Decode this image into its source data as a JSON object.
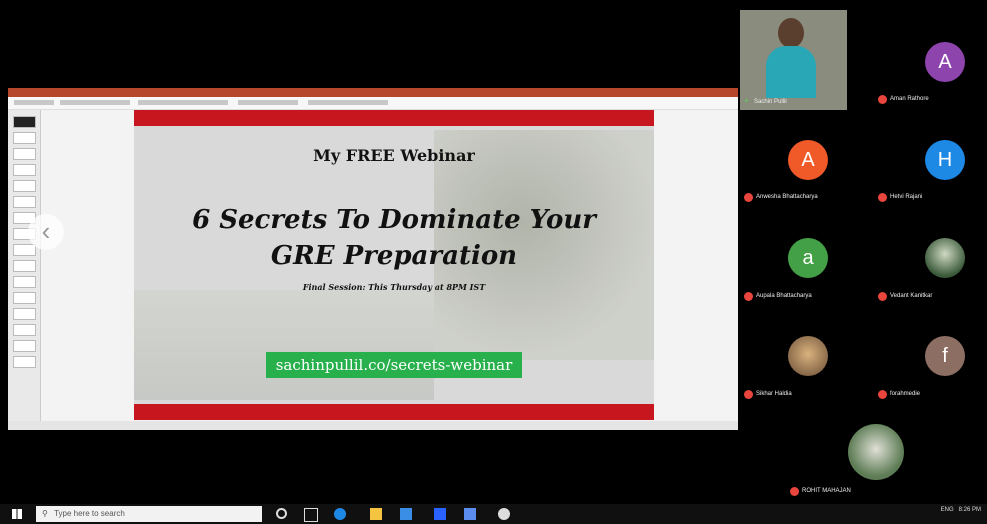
{
  "slide": {
    "heading": "My FREE Webinar",
    "title": "6 Secrets To Dominate Your GRE Preparation",
    "subtitle": "Final Session: This Thursday at 8PM IST",
    "link_text": "sachinpullil.co/secrets-webinar"
  },
  "participants": [
    {
      "initial": "",
      "name": "Sachin Pullil",
      "color": "#4a4a4a"
    },
    {
      "initial": "A",
      "name": "Aman Rathore",
      "color": "#8e44ad"
    },
    {
      "initial": "A",
      "name": "Anwesha Bhattacharya",
      "color": "#f05a28"
    },
    {
      "initial": "H",
      "name": "Hetvi Rajani",
      "color": "#1e88e5"
    },
    {
      "initial": "a",
      "name": "Aupala Bhattacharya",
      "color": "#43a047"
    },
    {
      "initial": "",
      "name": "Vedant Kanitkar",
      "color": "#2b2b2b"
    },
    {
      "initial": "",
      "name": "Sikhar Haldia",
      "color": "#6b4a3a"
    },
    {
      "initial": "f",
      "name": "forahmedie",
      "color": "#8d6e63"
    },
    {
      "initial": "",
      "name": "ROHIT MAHAJAN",
      "color": "#555555"
    }
  ],
  "taskbar": {
    "search_placeholder": "Type here to search",
    "lang": "ENG",
    "time": "8:26 PM"
  }
}
